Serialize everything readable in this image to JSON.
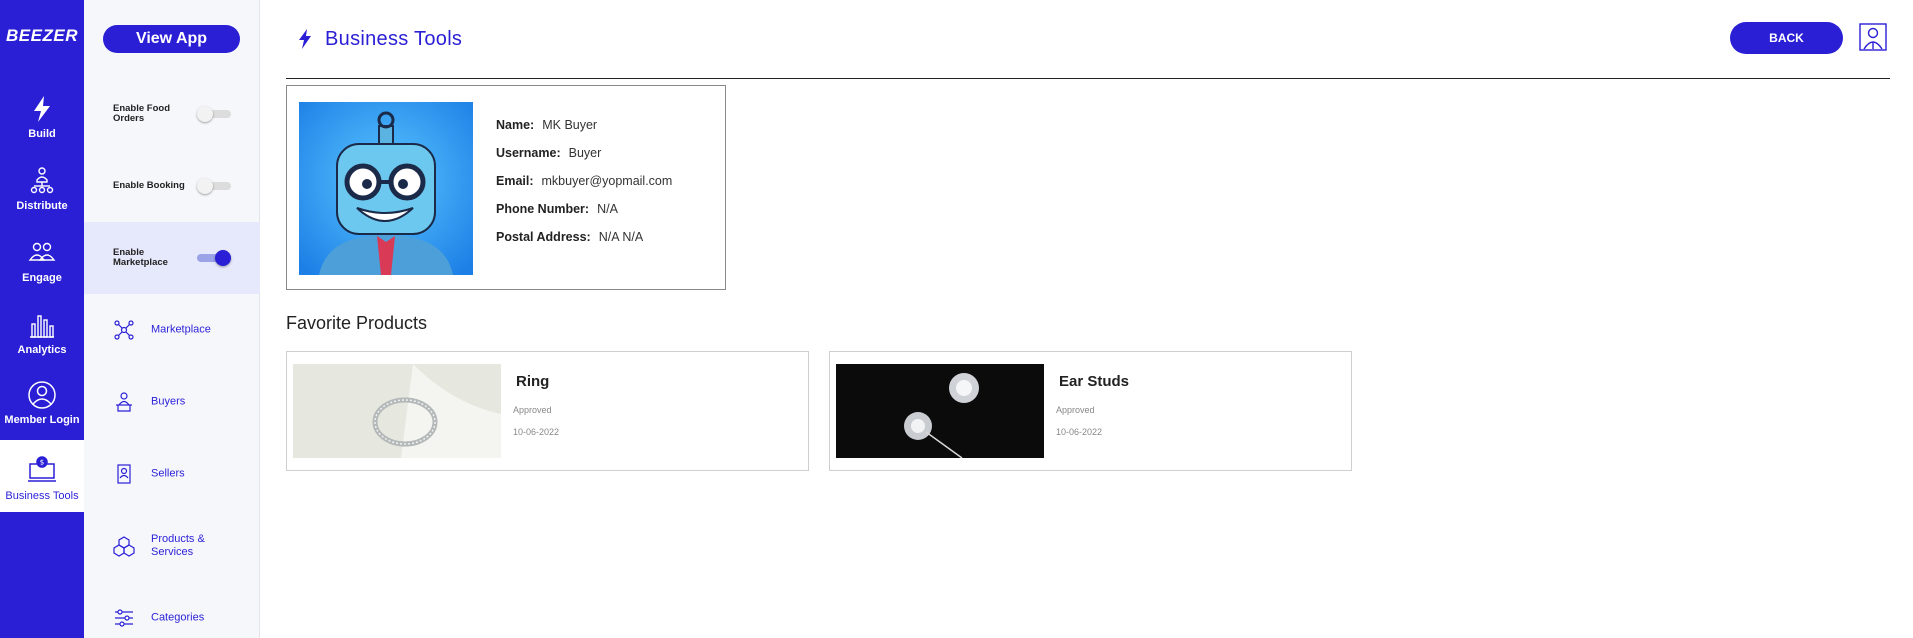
{
  "brand": {
    "name": "BEEZER",
    "accent": "#2b1fd6"
  },
  "leftnav": {
    "items": [
      {
        "label": "Build",
        "icon": "bolt-icon"
      },
      {
        "label": "Distribute",
        "icon": "network-icon"
      },
      {
        "label": "Engage",
        "icon": "people-icon"
      },
      {
        "label": "Analytics",
        "icon": "bar-chart-icon"
      },
      {
        "label": "Member Login",
        "icon": "user-circle-icon"
      },
      {
        "label": "Business Tools",
        "icon": "monitor-dollar-icon",
        "active": true
      }
    ]
  },
  "subnav": {
    "view_app": "View App",
    "toggles": [
      {
        "label": "Enable Food Orders",
        "on": false
      },
      {
        "label": "Enable Booking",
        "on": false
      },
      {
        "label": "Enable Marketplace",
        "on": true
      }
    ],
    "items": [
      {
        "label": "Marketplace",
        "icon": "marketplace-icon"
      },
      {
        "label": "Buyers",
        "icon": "buyers-icon"
      },
      {
        "label": "Sellers",
        "icon": "sellers-icon"
      },
      {
        "label": "Products & Services",
        "icon": "cubes-icon"
      },
      {
        "label": "Categories",
        "icon": "sliders-icon"
      }
    ]
  },
  "header": {
    "title": "Business Tools",
    "back_label": "BACK"
  },
  "user": {
    "name_label": "Name:",
    "name": "MK Buyer",
    "username_label": "Username:",
    "username": "Buyer",
    "email_label": "Email:",
    "email": "mkbuyer@yopmail.com",
    "phone_label": "Phone Number:",
    "phone": "N/A",
    "address_label": "Postal Address:",
    "address": "N/A N/A"
  },
  "favorites": {
    "title": "Favorite Products",
    "products": [
      {
        "name": "Ring",
        "status": "Approved",
        "date": "10-06-2022"
      },
      {
        "name": "Ear Studs",
        "status": "Approved",
        "date": "10-06-2022"
      }
    ]
  }
}
